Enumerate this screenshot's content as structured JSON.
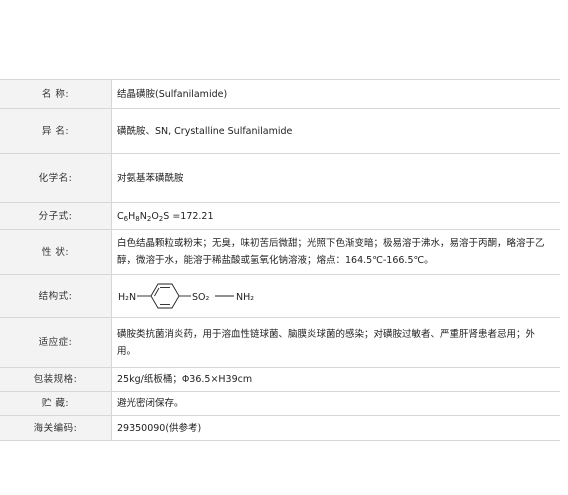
{
  "rows": [
    {
      "label": "名  称:",
      "value": "结晶磺胺(Sulfanilamide)"
    },
    {
      "label": "异  名:",
      "value": "磺酰胺、SN, Crystalline Sulfanilamide"
    },
    {
      "label": "化学名:",
      "value": "对氨基苯磺酰胺"
    },
    {
      "label": "分子式:",
      "formula": {
        "parts": [
          "C",
          "6",
          "H",
          "8",
          "N",
          "2",
          "O",
          "2",
          "S"
        ],
        "suffix": " =172.21"
      }
    },
    {
      "label": "性  状:",
      "value": "白色结晶颗粒或粉末；无臭，味初苦后微甜；光照下色渐变暗；极易溶于沸水，易溶于丙酮，略溶于乙醇，微溶于水，能溶于稀盐酸或氢氧化钠溶液；熔点：164.5℃-166.5℃。"
    },
    {
      "label": "结构式:",
      "structure": {
        "left_group": "H₂N",
        "mid_group": "SO₂",
        "right_group": "NH₂"
      }
    },
    {
      "label": "适应症:",
      "value": "磺胺类抗菌消炎药，用于溶血性链球菌、脑膜炎球菌的感染；对磺胺过敏者、严重肝肾患者忌用；外用。"
    },
    {
      "label": "包装规格:",
      "value": "25kg/纸板桶；Φ36.5×H39cm"
    },
    {
      "label": "贮  藏:",
      "value": "避光密闭保存。"
    },
    {
      "label": "海关编码:",
      "value": "29350090(供参考)"
    }
  ]
}
